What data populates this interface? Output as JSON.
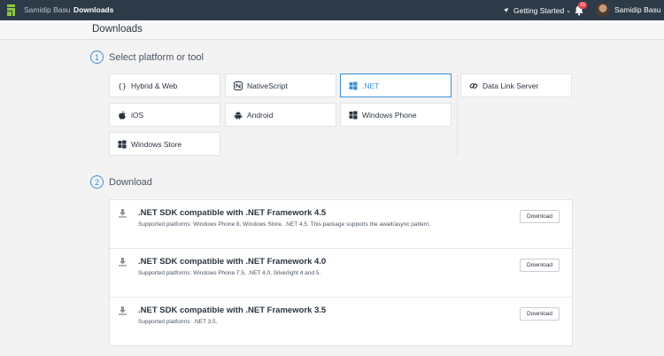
{
  "topbar": {
    "breadcrumb": [
      "Samidip Basu",
      "Downloads"
    ],
    "breadcrumb_separator": "›",
    "getting_started": "Getting Started",
    "notifications_count": "15",
    "user_name": "Samidip Basu",
    "icons": [
      "logo-icon",
      "rocket-icon",
      "bell-icon",
      "chevron-down-icon"
    ]
  },
  "page": {
    "title": "Downloads"
  },
  "step1": {
    "number": "1",
    "label": "Select platform or tool"
  },
  "step2": {
    "number": "2",
    "label": "Download"
  },
  "platforms": [
    {
      "label": "Hybrid & Web",
      "icon": "braces-icon"
    },
    {
      "label": "NativeScript",
      "icon": "nativescript-icon"
    },
    {
      "label": ".NET",
      "icon": "windows-icon",
      "selected": true
    },
    {
      "label": "Data Link Server",
      "icon": "link-icon"
    },
    {
      "label": "iOS",
      "icon": "apple-icon"
    },
    {
      "label": "Android",
      "icon": "android-icon"
    },
    {
      "label": "Windows Phone",
      "icon": "windows-icon"
    },
    {
      "label": "Windows Store",
      "icon": "windows-icon"
    }
  ],
  "downloads": [
    {
      "title": ".NET SDK compatible with .NET Framework 4.5",
      "desc": "Supported platforms: Windows Phone 8, Windows Store, .NET 4.5. This package supports the await/async pattern.",
      "button": "Download"
    },
    {
      "title": ".NET SDK compatible with .NET Framework 4.0",
      "desc": "Supported platforms: Windows Phone 7.5, .NET 4.0, Silverlight 4 and 5.",
      "button": "Download"
    },
    {
      "title": ".NET SDK compatible with .NET Framework 3.5",
      "desc": "Supported platforms: .NET 3.5.",
      "button": "Download"
    }
  ],
  "colors": {
    "topbar": "#2d3a48",
    "accent": "#3b8fd4",
    "logo": "#8dc63f",
    "badge": "#e5464c"
  }
}
